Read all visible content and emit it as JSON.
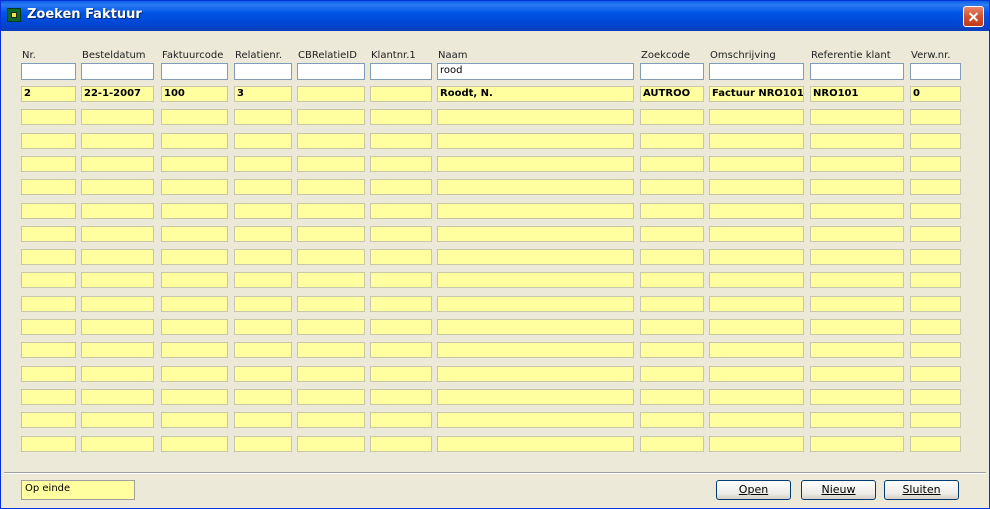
{
  "window": {
    "title": "Zoeken Faktuur"
  },
  "columns": [
    {
      "label": "Nr.",
      "filter": ""
    },
    {
      "label": "Besteldatum",
      "filter": ""
    },
    {
      "label": "Faktuurcode",
      "filter": ""
    },
    {
      "label": "Relatienr.",
      "filter": ""
    },
    {
      "label": "CBRelatieID",
      "filter": ""
    },
    {
      "label": "Klantnr.1",
      "filter": ""
    },
    {
      "label": "Naam",
      "filter": "rood"
    },
    {
      "label": "Zoekcode",
      "filter": ""
    },
    {
      "label": "Omschrijving",
      "filter": ""
    },
    {
      "label": "Referentie klant",
      "filter": ""
    },
    {
      "label": "Verw.nr.",
      "filter": ""
    }
  ],
  "rows": [
    [
      "2",
      "22-1-2007",
      "100",
      "3",
      "",
      "",
      "Roodt, N.",
      "AUTROO",
      "Factuur NRO101",
      "NRO101",
      "0"
    ],
    [
      "",
      "",
      "",
      "",
      "",
      "",
      "",
      "",
      "",
      "",
      ""
    ],
    [
      "",
      "",
      "",
      "",
      "",
      "",
      "",
      "",
      "",
      "",
      ""
    ],
    [
      "",
      "",
      "",
      "",
      "",
      "",
      "",
      "",
      "",
      "",
      ""
    ],
    [
      "",
      "",
      "",
      "",
      "",
      "",
      "",
      "",
      "",
      "",
      ""
    ],
    [
      "",
      "",
      "",
      "",
      "",
      "",
      "",
      "",
      "",
      "",
      ""
    ],
    [
      "",
      "",
      "",
      "",
      "",
      "",
      "",
      "",
      "",
      "",
      ""
    ],
    [
      "",
      "",
      "",
      "",
      "",
      "",
      "",
      "",
      "",
      "",
      ""
    ],
    [
      "",
      "",
      "",
      "",
      "",
      "",
      "",
      "",
      "",
      "",
      ""
    ],
    [
      "",
      "",
      "",
      "",
      "",
      "",
      "",
      "",
      "",
      "",
      ""
    ],
    [
      "",
      "",
      "",
      "",
      "",
      "",
      "",
      "",
      "",
      "",
      ""
    ],
    [
      "",
      "",
      "",
      "",
      "",
      "",
      "",
      "",
      "",
      "",
      ""
    ],
    [
      "",
      "",
      "",
      "",
      "",
      "",
      "",
      "",
      "",
      "",
      ""
    ],
    [
      "",
      "",
      "",
      "",
      "",
      "",
      "",
      "",
      "",
      "",
      ""
    ],
    [
      "",
      "",
      "",
      "",
      "",
      "",
      "",
      "",
      "",
      "",
      ""
    ],
    [
      "",
      "",
      "",
      "",
      "",
      "",
      "",
      "",
      "",
      "",
      ""
    ]
  ],
  "status": {
    "text": "Op einde"
  },
  "buttons": {
    "open": "Open",
    "new": "Nieuw",
    "close": "Sluiten"
  },
  "colors": {
    "cell": "#FFFFA0",
    "titlebar": "#0055E5",
    "background": "#ECE9D8"
  }
}
